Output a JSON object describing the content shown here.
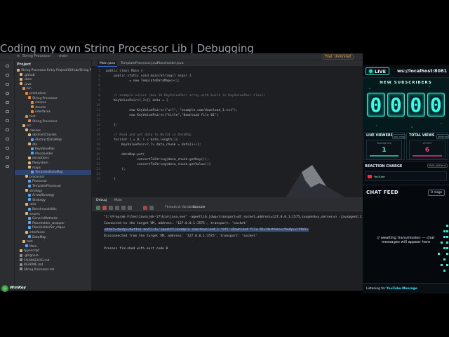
{
  "stream_title": "Coding my own String Processor Lib | Debugging",
  "ide": {
    "top_bar": {
      "project": "String Processor",
      "branch": "main",
      "trial": "Trial: Unlimited"
    },
    "project_panel_title": "Project",
    "tree": [
      {
        "label": "String Processor  Entry Project/GitHub/String Processor",
        "indent": 0,
        "color": "#dcb67a"
      },
      {
        "label": ".github",
        "indent": 1,
        "color": "#dcb67a"
      },
      {
        "label": ".idea",
        "indent": 1,
        "color": "#dcb67a"
      },
      {
        "label": ".java",
        "indent": 1,
        "color": "#dcb67a"
      },
      {
        "label": "bin",
        "indent": 2,
        "color": "#e08b3a"
      },
      {
        "label": "production",
        "indent": 3,
        "color": "#e08b3a"
      },
      {
        "label": "String Processor",
        "indent": 4,
        "color": "#e08b3a"
      },
      {
        "label": "classes",
        "indent": 5,
        "color": "#e08b3a"
      },
      {
        "label": "structs",
        "indent": 5,
        "color": "#e08b3a"
      },
      {
        "label": "interfaces",
        "indent": 5,
        "color": "#e08b3a"
      },
      {
        "label": "test",
        "indent": 3,
        "color": "#e08b3a"
      },
      {
        "label": "String Processor",
        "indent": 4,
        "color": "#e08b3a"
      },
      {
        "label": "src",
        "indent": 2,
        "color": "#dcb67a"
      },
      {
        "label": "classes",
        "indent": 3,
        "color": "#dcb67a"
      },
      {
        "label": "abstractClasses",
        "indent": 4,
        "color": "#dcb67a"
      },
      {
        "label": "AbstractDataMap",
        "indent": 5,
        "color": "#56a8f5"
      },
      {
        "label": "dto",
        "indent": 4,
        "color": "#dcb67a"
      },
      {
        "label": "KeyValuePair",
        "indent": 5,
        "color": "#56a8f5"
      },
      {
        "label": "Placeholder",
        "indent": 5,
        "color": "#56a8f5"
      },
      {
        "label": "exceptions",
        "indent": 4,
        "color": "#dcb67a"
      },
      {
        "label": "filesystem",
        "indent": 4,
        "color": "#dcb67a"
      },
      {
        "label": "maps",
        "indent": 4,
        "color": "#dcb67a"
      },
      {
        "label": "TemplateDataMap",
        "indent": 5,
        "color": "#56a8f5",
        "selected": true
      },
      {
        "label": "processor",
        "indent": 3,
        "color": "#dcb67a"
      },
      {
        "label": "Processor",
        "indent": 4,
        "color": "#56a8f5"
      },
      {
        "label": "TemplateProcessor",
        "indent": 4,
        "color": "#56a8f5"
      },
      {
        "label": "strategy",
        "indent": 3,
        "color": "#dcb67a"
      },
      {
        "label": "ArrowStrategy",
        "indent": 4,
        "color": "#56a8f5"
      },
      {
        "label": "Strategy",
        "indent": 4,
        "color": "#56a8f5"
      },
      {
        "label": "utils",
        "indent": 3,
        "color": "#dcb67a"
      },
      {
        "label": "BenchmarkUtils",
        "indent": 4,
        "color": "#56a8f5"
      },
      {
        "label": "enums",
        "indent": 3,
        "color": "#dcb67a"
      },
      {
        "label": "GenericMethods",
        "indent": 4,
        "color": "#56a8f5"
      },
      {
        "label": "Placeholder_wrapper",
        "indent": 4,
        "color": "#56a8f5"
      },
      {
        "label": "PlaceholderStr_rdque",
        "indent": 4,
        "color": "#56a8f5"
      },
      {
        "label": "interfaces",
        "indent": 3,
        "color": "#dcb67a"
      },
      {
        "label": "DataMap",
        "indent": 4,
        "color": "#56a8f5"
      },
      {
        "label": "test",
        "indent": 2,
        "color": "#dcb67a"
      },
      {
        "label": "Main",
        "indent": 3,
        "color": "#56a8f5"
      },
      {
        "label": "typescript",
        "indent": 1,
        "color": "#dcb67a"
      },
      {
        "label": ".gitignore",
        "indent": 1,
        "color": "#8b8f96"
      },
      {
        "label": "CHANGELOG.md",
        "indent": 1,
        "color": "#8b8f96"
      },
      {
        "label": "README.md",
        "indent": 1,
        "color": "#8b8f96"
      },
      {
        "label": "String Processor.iml",
        "indent": 1,
        "color": "#8b8f96"
      }
    ],
    "tabs": [
      "Main.java",
      "TemplateProcessor.java",
      "Placeholder.java"
    ],
    "line_numbers": [
      "3",
      "4",
      "5",
      "6",
      "7",
      "8",
      "9",
      "10",
      "11",
      "12",
      "13",
      "14",
      "15",
      "16",
      "17",
      "18",
      "19",
      "20",
      "21",
      "22",
      "23",
      "24",
      "25"
    ],
    "code_lines": [
      "public class Main {",
      "    public static void main(String[] args) {",
      "            = new TemplateDataMap<>();",
      "",
      "",
      "    // example values (max 16 KeyValuePair array with build in KeyValuePair class)",
      "    KeyValuePair<?,?>[] data = {",
      "",
      "            new KeyValuePair<>(\"url\", \"example.com/download_1.txt\"),",
      "            new KeyValuePair<>(\"title\",\"Download file 01\")",
      "",
      "    };",
      "",
      "    // Read and put data to Build in DataMap",
      "    for(int i = 0; i < data.length;){",
      "        KeyValuePair<?,?> data_chunk = data[i++];",
      "",
      "        dataMap.put(",
      "                convertToString(data_chunk.getKey()),",
      "                convertToString(data_chunk.getValue())",
      "        );",
      "",
      "    }"
    ],
    "debug": {
      "tabs": [
        "Debug",
        "Main"
      ],
      "sub_tabs": [
        "Threads & Variables",
        "Console"
      ],
      "console_lines": [
        "\"C:\\Program Files\\Java\\jdk-17\\bin\\java.exe\" -agentlib:jdwp=transport=dt_socket,address=127.0.0.1:1575,suspend=y,server=n -javaagent:C:\\Use",
        "Connected to the target VM, address: '127.0.0.1:1575', transport: 'socket'",
        "<html><body><button onclick='openUrl(example.com/download_1.txt)'>Download file 01</button></body></html>",
        "Disconnected from the target VM, address: '127.0.0.1:1575', transport: 'socket'",
        "",
        "Process finished with exit code 0"
      ]
    },
    "status": "String Processor > test"
  },
  "overlay": {
    "live_label": "LIVE",
    "ws_url": "ws://localhost:8081",
    "new_subscribers_label": "NEW SUBSCRIBERS",
    "subscriber_digits": [
      "0",
      "0",
      "0",
      "0"
    ],
    "live_viewers": {
      "title": "LIVE VIEWERS",
      "pill": "last now",
      "caption": "YouTube live",
      "value": "1"
    },
    "total_views": {
      "title": "TOTAL VIEWS",
      "pill": "lifetime",
      "caption": "all time",
      "value": "6"
    },
    "reaction_charge": {
      "title": "REACTION CHARGE",
      "pill": "Multi-platform",
      "source": "YouTube"
    },
    "chat_feed": {
      "title": "CHAT FEED",
      "count": "0 msgs",
      "empty_message": "// awaiting transmission — chat messages will appear here",
      "footer_prefix": "Listening for ",
      "footer_source": "YouTube.Message"
    },
    "accent": "#2ff2d6",
    "pink": "#ff3b8f"
  },
  "winkey_logo": "WinKey"
}
